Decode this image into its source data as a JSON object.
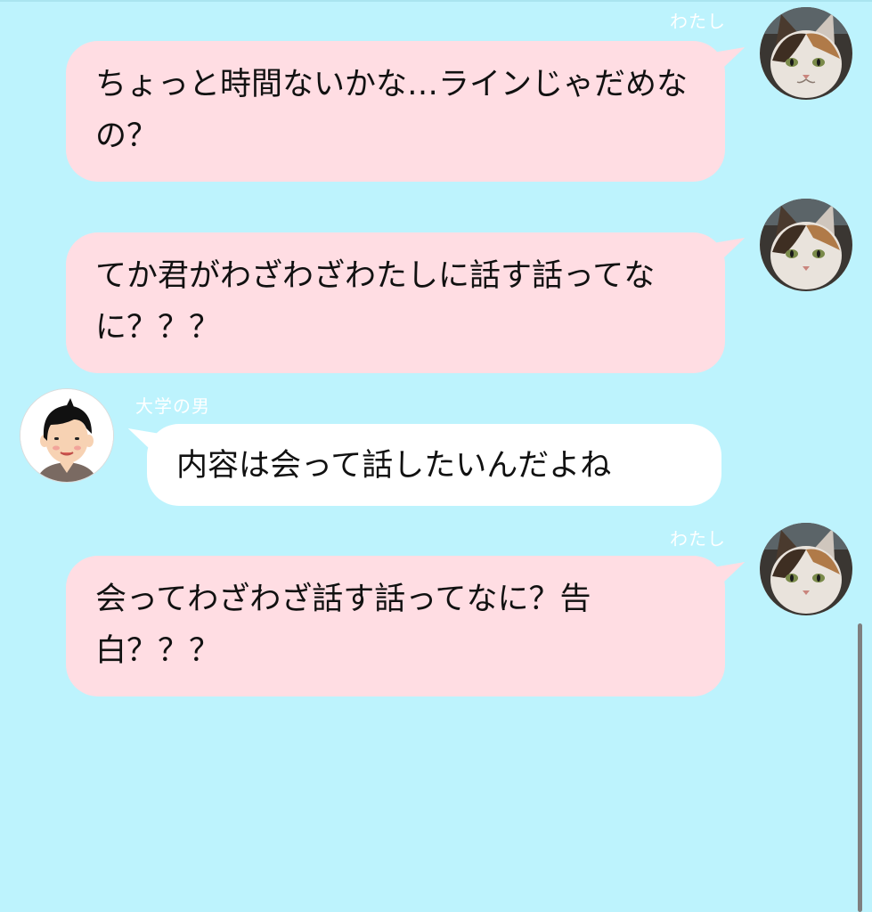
{
  "chat": {
    "me_name": "わたし",
    "other_name": "大学の男",
    "messages": [
      {
        "sender": "わたし",
        "text": "ちょっと時間ないかな…ラインじゃだめなの？"
      },
      {
        "sender": "わたし",
        "text": "てか君がわざわざわたしに話す話ってなに？？？"
      },
      {
        "sender": "大学の男",
        "text": "内容は会って話したいんだよね"
      },
      {
        "sender": "わたし",
        "text": "会ってわざわざ話す話ってなに？告白？？？"
      }
    ]
  },
  "colors": {
    "background": "#bdf3fd",
    "my_bubble": "#ffdde3",
    "other_bubble": "#ffffff",
    "name_text": "#ffffff"
  },
  "icons": {
    "me_avatar": "cat-photo-avatar",
    "other_avatar": "man-illustration-avatar"
  }
}
